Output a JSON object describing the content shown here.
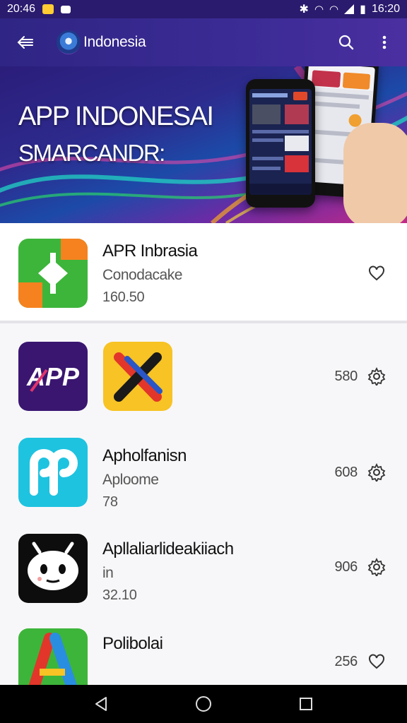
{
  "status_bar": {
    "time_left": "20:46",
    "time_right": "16:20"
  },
  "app_bar": {
    "title": "Indonesia",
    "back_icon": "back-arrow-icon",
    "search_icon": "search-icon",
    "menu_icon": "more-vert-icon"
  },
  "banner": {
    "line1": "APP INDONESAI",
    "line2": "SMARCANDR:"
  },
  "apps": [
    {
      "name": "APR Inbrasia",
      "subtitle": "Conodacake",
      "meta": "160.50",
      "icon": "code-arrows-icon"
    },
    {
      "count": "580",
      "icons": [
        "app-logo-icon",
        "x-logo-icon"
      ]
    },
    {
      "name": "Apholfanisn",
      "subtitle": "Aploome",
      "meta": "78",
      "count": "608",
      "icon": "p-logo-icon"
    },
    {
      "name": "Apllaliarlideakiiach",
      "subtitle": "in",
      "meta": "32.10",
      "count": "906",
      "icon": "robot-face-icon"
    },
    {
      "name": "Polibolai",
      "count": "256",
      "icon": "a-logo-icon"
    }
  ],
  "colors": {
    "app_bar": "#2f2584",
    "accent_green": "#3db53a",
    "accent_orange": "#f5821f",
    "purple_icon": "#3a1670",
    "cyan_icon": "#1ec3e0",
    "yellow_icon": "#f7c325"
  }
}
